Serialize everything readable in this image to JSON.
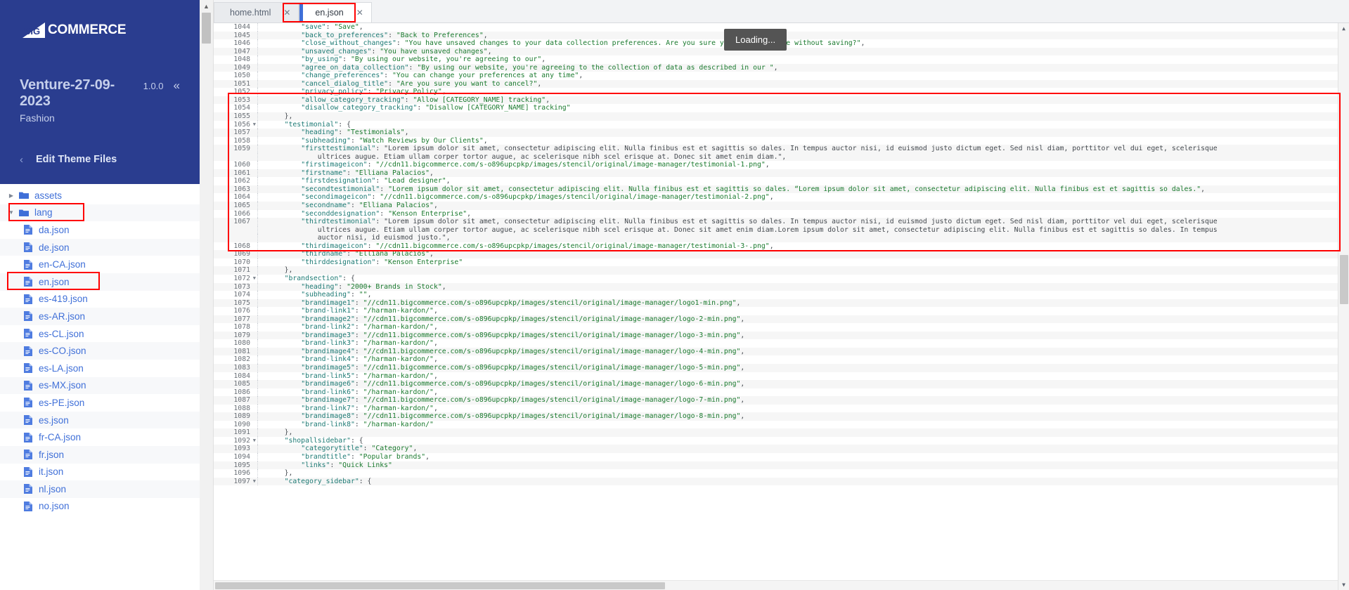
{
  "brand": {
    "logo_text": "COMMERCE",
    "logo_mark": "bigcommerce-logo-icon"
  },
  "theme": {
    "name": "Venture-27-09-2023",
    "version": "1.0.0",
    "collapse_icon": "«",
    "sub": "Fashion",
    "back_icon": "‹",
    "edit_label": "Edit Theme Files"
  },
  "filetree": [
    {
      "label": "assets",
      "type": "folder",
      "state": "collapsed",
      "indent": 0,
      "highlighted": false
    },
    {
      "label": "lang",
      "type": "folder",
      "state": "expanded",
      "indent": 0,
      "highlighted": true
    },
    {
      "label": "da.json",
      "type": "file",
      "indent": 1,
      "highlighted": false
    },
    {
      "label": "de.json",
      "type": "file",
      "indent": 1,
      "highlighted": false
    },
    {
      "label": "en-CA.json",
      "type": "file",
      "indent": 1,
      "highlighted": false
    },
    {
      "label": "en.json",
      "type": "file",
      "indent": 1,
      "highlighted": true
    },
    {
      "label": "es-419.json",
      "type": "file",
      "indent": 1,
      "highlighted": false
    },
    {
      "label": "es-AR.json",
      "type": "file",
      "indent": 1,
      "highlighted": false
    },
    {
      "label": "es-CL.json",
      "type": "file",
      "indent": 1,
      "highlighted": false
    },
    {
      "label": "es-CO.json",
      "type": "file",
      "indent": 1,
      "highlighted": false
    },
    {
      "label": "es-LA.json",
      "type": "file",
      "indent": 1,
      "highlighted": false
    },
    {
      "label": "es-MX.json",
      "type": "file",
      "indent": 1,
      "highlighted": false
    },
    {
      "label": "es-PE.json",
      "type": "file",
      "indent": 1,
      "highlighted": false
    },
    {
      "label": "es.json",
      "type": "file",
      "indent": 1,
      "highlighted": false
    },
    {
      "label": "fr-CA.json",
      "type": "file",
      "indent": 1,
      "highlighted": false
    },
    {
      "label": "fr.json",
      "type": "file",
      "indent": 1,
      "highlighted": false
    },
    {
      "label": "it.json",
      "type": "file",
      "indent": 1,
      "highlighted": false
    },
    {
      "label": "nl.json",
      "type": "file",
      "indent": 1,
      "highlighted": false
    },
    {
      "label": "no.json",
      "type": "file",
      "indent": 1,
      "highlighted": false
    }
  ],
  "tabs": [
    {
      "label": "home.html",
      "active": false,
      "close_icon": "✕"
    },
    {
      "label": "en.json",
      "active": true,
      "close_icon": "✕"
    }
  ],
  "tooltip": {
    "text": "Loading..."
  },
  "editor": {
    "first_line": 1044,
    "lines": [
      {
        "n": 1044,
        "fold": false,
        "text": "        \"save\": \"Save\","
      },
      {
        "n": 1045,
        "fold": false,
        "text": "        \"back_to_preferences\": \"Back to Preferences\","
      },
      {
        "n": 1046,
        "fold": false,
        "text": "        \"close_without_changes\": \"You have unsaved changes to your data collection preferences. Are you sure you want to close without saving?\","
      },
      {
        "n": 1047,
        "fold": false,
        "text": "        \"unsaved_changes\": \"You have unsaved changes\","
      },
      {
        "n": 1048,
        "fold": false,
        "text": "        \"by_using\": \"By using our website, you're agreeing to our\","
      },
      {
        "n": 1049,
        "fold": false,
        "text": "        \"agree_on_data_collection\": \"By using our website, you're agreeing to the collection of data as described in our \","
      },
      {
        "n": 1050,
        "fold": false,
        "text": "        \"change_preferences\": \"You can change your preferences at any time\","
      },
      {
        "n": 1051,
        "fold": false,
        "text": "        \"cancel_dialog_title\": \"Are you sure you want to cancel?\","
      },
      {
        "n": 1052,
        "fold": false,
        "text": "        \"privacy_policy\": \"Privacy Policy\","
      },
      {
        "n": 1053,
        "fold": false,
        "text": "        \"allow_category_tracking\": \"Allow [CATEGORY_NAME] tracking\","
      },
      {
        "n": 1054,
        "fold": false,
        "text": "        \"disallow_category_tracking\": \"Disallow [CATEGORY_NAME] tracking\""
      },
      {
        "n": 1055,
        "fold": false,
        "text": "    },"
      },
      {
        "n": 1056,
        "fold": true,
        "text": "    \"testimonial\": {"
      },
      {
        "n": 1057,
        "fold": false,
        "text": "        \"heading\": \"Testimonials\","
      },
      {
        "n": 1058,
        "fold": false,
        "text": "        \"subheading\": \"Watch Reviews by Our Clients\","
      },
      {
        "n": 1059,
        "fold": false,
        "text": "        \"firsttestimonial\": \"Lorem ipsum dolor sit amet, consectetur adipiscing elit. Nulla finibus est et sagittis so dales. In tempus auctor nisi, id euismod justo dictum eget. Sed nisl diam, porttitor vel dui eget, scelerisque\n            ultrices augue. Etiam ullam corper tortor augue, ac scelerisque nibh scel erisque at. Donec sit amet enim diam.\","
      },
      {
        "n": 1060,
        "fold": false,
        "text": "        \"firstimageicon\": \"//cdn11.bigcommerce.com/s-o896upcpkp/images/stencil/original/image-manager/testimonial-1.png\","
      },
      {
        "n": 1061,
        "fold": false,
        "text": "        \"firstname\": \"Elliana Palacios\","
      },
      {
        "n": 1062,
        "fold": false,
        "text": "        \"firstdesignation\": \"Lead designer\","
      },
      {
        "n": 1063,
        "fold": false,
        "text": "        \"secondtestimonial\": \"Lorem ipsum dolor sit amet, consectetur adipiscing elit. Nulla finibus est et sagittis so dales. “Lorem ipsum dolor sit amet, consectetur adipiscing elit. Nulla finibus est et sagittis so dales.\","
      },
      {
        "n": 1064,
        "fold": false,
        "text": "        \"secondimageicon\": \"//cdn11.bigcommerce.com/s-o896upcpkp/images/stencil/original/image-manager/testimonial-2.png\","
      },
      {
        "n": 1065,
        "fold": false,
        "text": "        \"secondname\": \"Elliana Palacios\","
      },
      {
        "n": 1066,
        "fold": false,
        "text": "        \"seconddesignation\": \"Kenson Enterprise\","
      },
      {
        "n": 1067,
        "fold": false,
        "text": "        \"thirdtestimonial\": \"Lorem ipsum dolor sit amet, consectetur adipiscing elit. Nulla finibus est et sagittis so dales. In tempus auctor nisi, id euismod justo dictum eget. Sed nisl diam, porttitor vel dui eget, scelerisque\n            ultrices augue. Etiam ullam corper tortor augue, ac scelerisque nibh scel erisque at. Donec sit amet enim diam.Lorem ipsum dolor sit amet, consectetur adipiscing elit. Nulla finibus est et sagittis so dales. In tempus\n            auctor nisi, id euismod justo.\","
      },
      {
        "n": 1068,
        "fold": false,
        "text": "        \"thirdimageicon\": \"//cdn11.bigcommerce.com/s-o896upcpkp/images/stencil/original/image-manager/testimonial-3-.png\","
      },
      {
        "n": 1069,
        "fold": false,
        "text": "        \"thirdname\": \"Elliana Palacios\","
      },
      {
        "n": 1070,
        "fold": false,
        "text": "        \"thirddesignation\": \"Kenson Enterprise\""
      },
      {
        "n": 1071,
        "fold": false,
        "text": "    },"
      },
      {
        "n": 1072,
        "fold": true,
        "text": "    \"brandsection\": {"
      },
      {
        "n": 1073,
        "fold": false,
        "text": "        \"heading\": \"2000+ Brands in Stock\","
      },
      {
        "n": 1074,
        "fold": false,
        "text": "        \"subheading\": \"\","
      },
      {
        "n": 1075,
        "fold": false,
        "text": "        \"brandimage1\": \"//cdn11.bigcommerce.com/s-o896upcpkp/images/stencil/original/image-manager/logo1-min.png\","
      },
      {
        "n": 1076,
        "fold": false,
        "text": "        \"brand-link1\": \"/harman-kardon/\","
      },
      {
        "n": 1077,
        "fold": false,
        "text": "        \"brandimage2\": \"//cdn11.bigcommerce.com/s-o896upcpkp/images/stencil/original/image-manager/logo-2-min.png\","
      },
      {
        "n": 1078,
        "fold": false,
        "text": "        \"brand-link2\": \"/harman-kardon/\","
      },
      {
        "n": 1079,
        "fold": false,
        "text": "        \"brandimage3\": \"//cdn11.bigcommerce.com/s-o896upcpkp/images/stencil/original/image-manager/logo-3-min.png\","
      },
      {
        "n": 1080,
        "fold": false,
        "text": "        \"brand-link3\": \"/harman-kardon/\","
      },
      {
        "n": 1081,
        "fold": false,
        "text": "        \"brandimage4\": \"//cdn11.bigcommerce.com/s-o896upcpkp/images/stencil/original/image-manager/logo-4-min.png\","
      },
      {
        "n": 1082,
        "fold": false,
        "text": "        \"brand-link4\": \"/harman-kardon/\","
      },
      {
        "n": 1083,
        "fold": false,
        "text": "        \"brandimage5\": \"//cdn11.bigcommerce.com/s-o896upcpkp/images/stencil/original/image-manager/logo-5-min.png\","
      },
      {
        "n": 1084,
        "fold": false,
        "text": "        \"brand-link5\": \"/harman-kardon/\","
      },
      {
        "n": 1085,
        "fold": false,
        "text": "        \"brandimage6\": \"//cdn11.bigcommerce.com/s-o896upcpkp/images/stencil/original/image-manager/logo-6-min.png\","
      },
      {
        "n": 1086,
        "fold": false,
        "text": "        \"brand-link6\": \"/harman-kardon/\","
      },
      {
        "n": 1087,
        "fold": false,
        "text": "        \"brandimage7\": \"//cdn11.bigcommerce.com/s-o896upcpkp/images/stencil/original/image-manager/logo-7-min.png\","
      },
      {
        "n": 1088,
        "fold": false,
        "text": "        \"brand-link7\": \"/harman-kardon/\","
      },
      {
        "n": 1089,
        "fold": false,
        "text": "        \"brandimage8\": \"//cdn11.bigcommerce.com/s-o896upcpkp/images/stencil/original/image-manager/logo-8-min.png\","
      },
      {
        "n": 1090,
        "fold": false,
        "text": "        \"brand-link8\": \"/harman-kardon/\""
      },
      {
        "n": 1091,
        "fold": false,
        "text": "    },"
      },
      {
        "n": 1092,
        "fold": true,
        "text": "    \"shopallsidebar\": {"
      },
      {
        "n": 1093,
        "fold": false,
        "text": "        \"categorytitle\": \"Category\","
      },
      {
        "n": 1094,
        "fold": false,
        "text": "        \"brandtitle\": \"Popular brands\","
      },
      {
        "n": 1095,
        "fold": false,
        "text": "        \"links\": \"Quick Links\""
      },
      {
        "n": 1096,
        "fold": false,
        "text": "    },"
      },
      {
        "n": 1097,
        "fold": true,
        "text": "    \"category_sidebar\": {"
      }
    ]
  },
  "colors": {
    "nav_bg": "#2a3d8f",
    "link_blue": "#3f6fd8",
    "highlight_red": "#ff0000",
    "tooltip_bg": "#545454",
    "string_green": "#1a7a2e",
    "key_teal": "#1d7a74"
  }
}
